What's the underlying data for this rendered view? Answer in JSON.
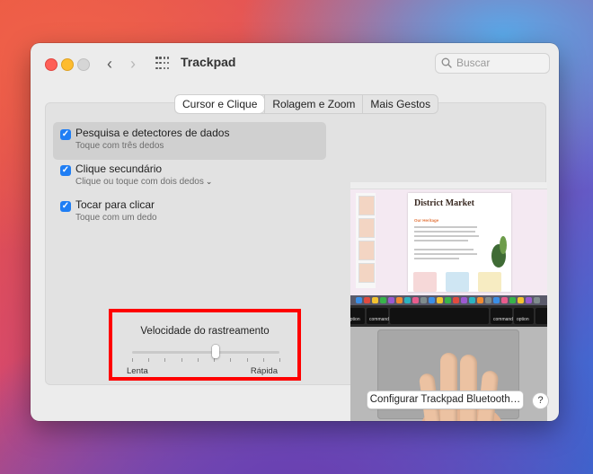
{
  "window": {
    "title": "Trackpad"
  },
  "search": {
    "placeholder": "Buscar"
  },
  "tabs": [
    {
      "label": "Cursor e Clique",
      "active": true
    },
    {
      "label": "Rolagem e Zoom",
      "active": false
    },
    {
      "label": "Mais Gestos",
      "active": false
    }
  ],
  "options": [
    {
      "title": "Pesquisa e detectores de dados",
      "subtitle": "Toque com três dedos",
      "checked": true
    },
    {
      "title": "Clique secundário",
      "subtitle": "Clique ou toque com dois dedos",
      "checked": true
    },
    {
      "title": "Tocar para clicar",
      "subtitle": "Toque com um dedo",
      "checked": true
    }
  ],
  "tracking_speed": {
    "label": "Velocidade do rastreamento",
    "min_label": "Lenta",
    "max_label": "Rápida",
    "level_fraction": 0.57,
    "highlight_color": "#ff0000"
  },
  "preview": {
    "document_title": "District Market",
    "section_heading": "Our Heritage",
    "key_left_top": "⌘",
    "key_command": "command",
    "key_option": "option"
  },
  "footer": {
    "bluetooth_button": "Configurar Trackpad Bluetooth…",
    "help": "?"
  },
  "colors": {
    "checkbox_accent": "#1f7ef4",
    "close": "#fe5f57",
    "minimize": "#febc2e"
  }
}
